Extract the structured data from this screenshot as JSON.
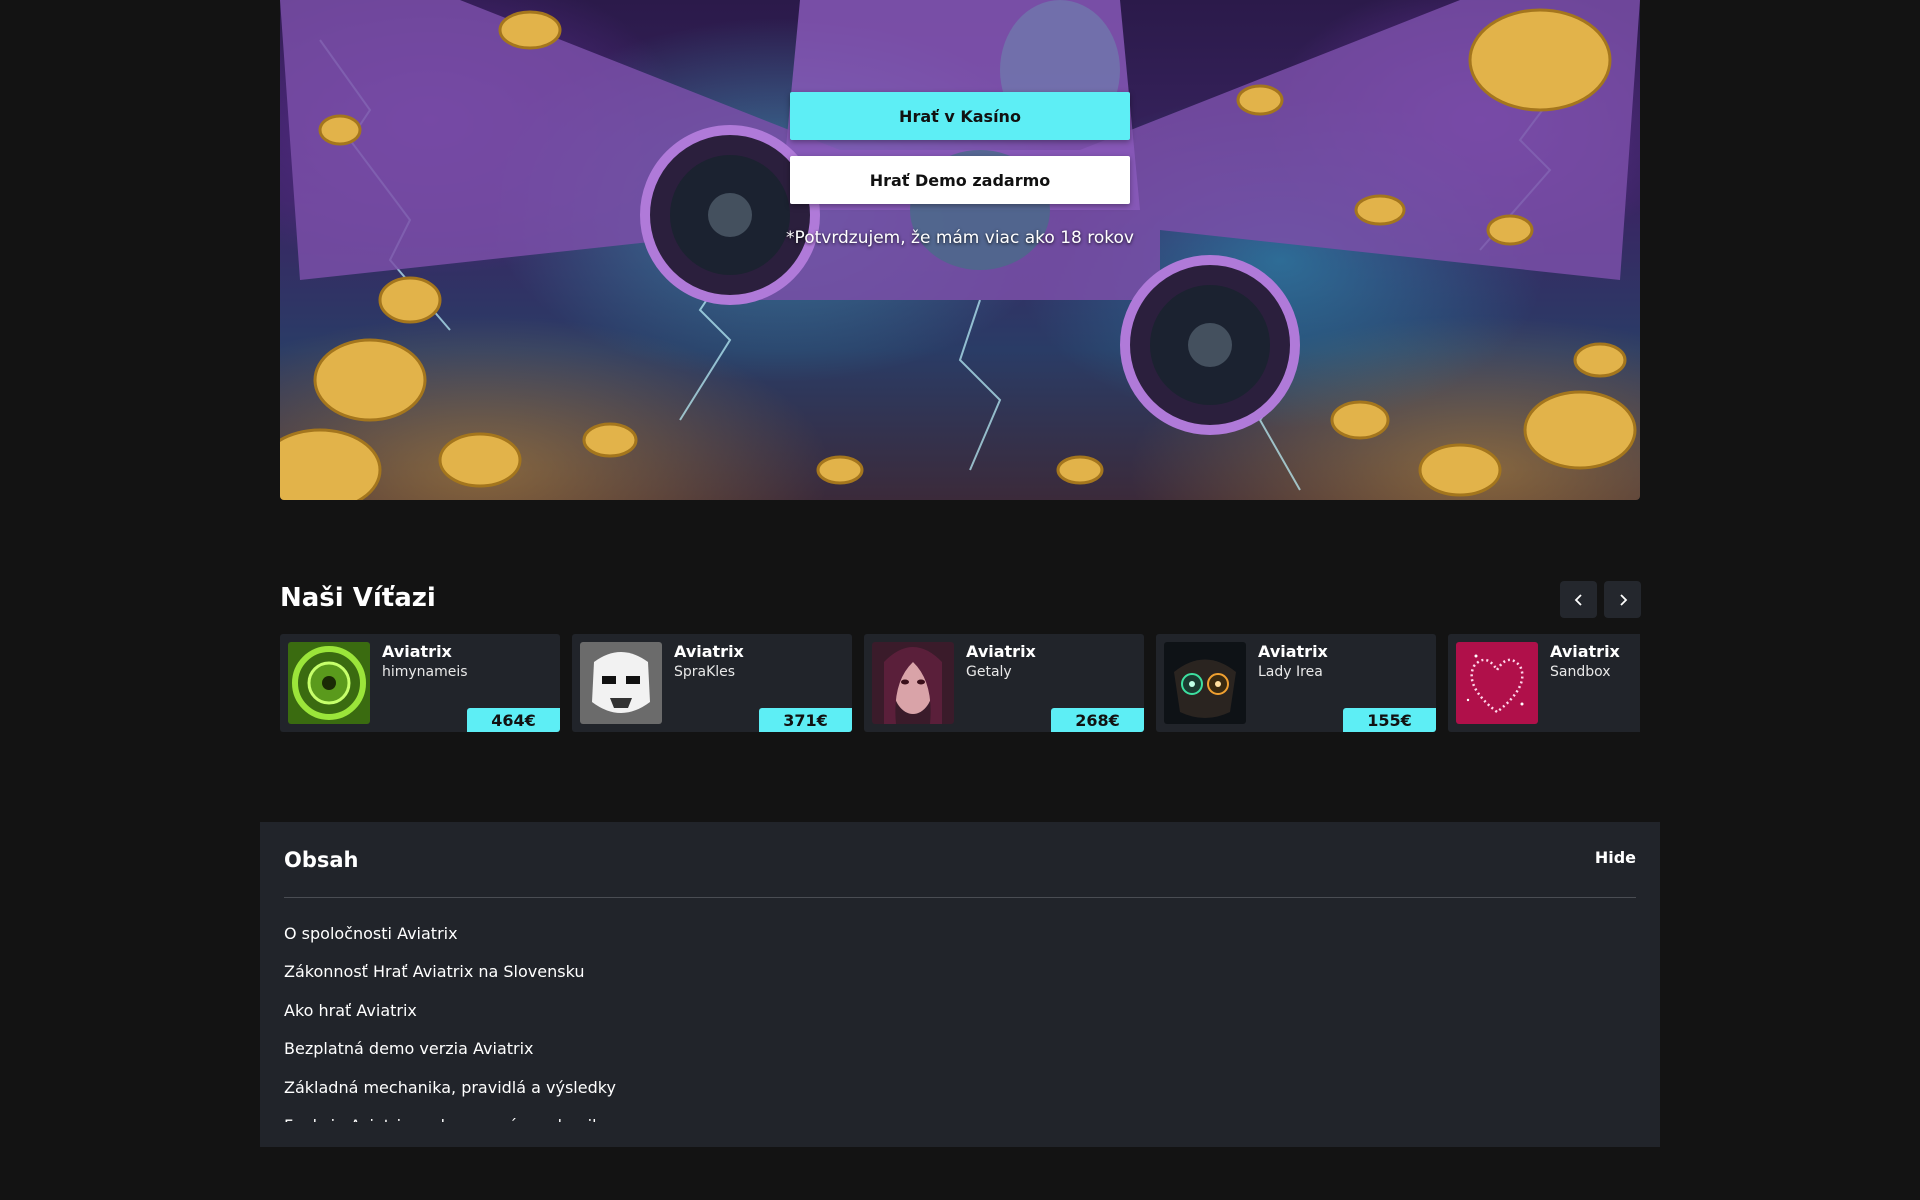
{
  "hero": {
    "primary_button": "Hrať v Kasíno",
    "secondary_button": "Hrať Demo zadarmo",
    "age_confirmation": "*Potvrdzujem, že mám viac ako 18 rokov"
  },
  "winners": {
    "title": "Naši Víťazi",
    "prev_icon": "chevron-left-icon",
    "next_icon": "chevron-right-icon",
    "items": [
      {
        "game": "Aviatrix",
        "user": "himynameis",
        "amount": "464€"
      },
      {
        "game": "Aviatrix",
        "user": "SpraKles",
        "amount": "371€"
      },
      {
        "game": "Aviatrix",
        "user": "Getaly",
        "amount": "268€"
      },
      {
        "game": "Aviatrix",
        "user": "Lady Irea",
        "amount": "155€"
      },
      {
        "game": "Aviatrix",
        "user": "Sandbox",
        "amount": ""
      }
    ]
  },
  "toc": {
    "title": "Obsah",
    "hide_label": "Hide",
    "items": [
      "O spoločnosti Aviatrix",
      "Zákonnosť Hrať Aviatrix na Slovensku",
      "Ako hrať Aviatrix",
      "Bezplatná demo verzia Aviatrix",
      "Základná mechanika, pravidlá a výsledky",
      "Funkcie Aviatrixu a bonusová mechanika"
    ]
  },
  "colors": {
    "accent": "#5deef5",
    "background": "#131313",
    "card": "#21242a"
  }
}
